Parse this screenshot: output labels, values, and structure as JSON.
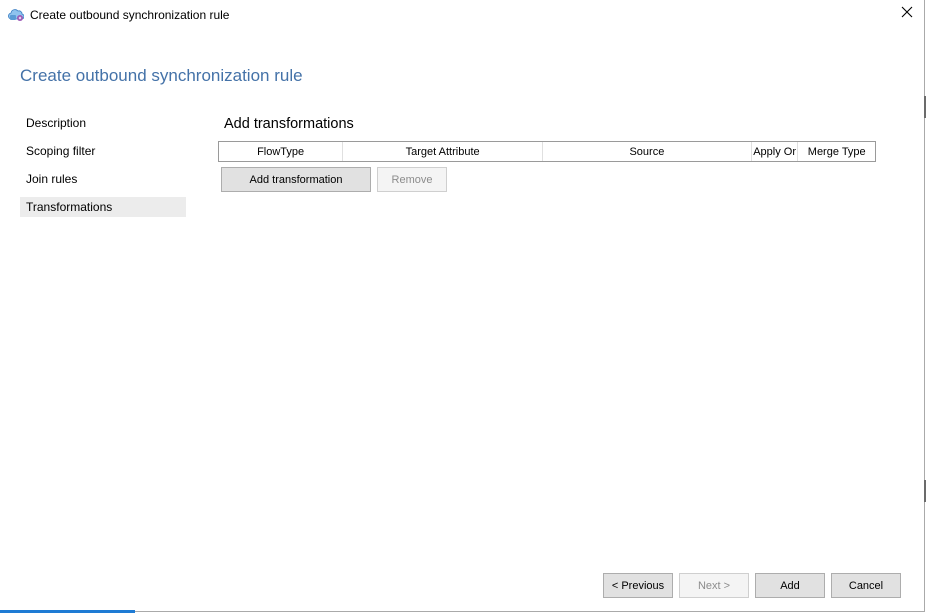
{
  "window": {
    "title": "Create outbound synchronization rule",
    "close_symbol": "✕"
  },
  "page": {
    "title": "Create outbound synchronization rule"
  },
  "nav": {
    "items": [
      {
        "label": "Description",
        "selected": false
      },
      {
        "label": "Scoping filter",
        "selected": false
      },
      {
        "label": "Join rules",
        "selected": false
      },
      {
        "label": "Transformations",
        "selected": true
      }
    ]
  },
  "main": {
    "section_title": "Add transformations",
    "grid": {
      "columns": [
        "FlowType",
        "Target Attribute",
        "Source",
        "Apply Or",
        "Merge Type"
      ],
      "rows": []
    },
    "buttons": {
      "add_transformation": "Add transformation",
      "remove": "Remove"
    }
  },
  "footer": {
    "previous": "< Previous",
    "next": "Next >",
    "add": "Add",
    "cancel": "Cancel"
  },
  "colors": {
    "title_accent": "#4472a8",
    "selected_nav_bg": "#ececec",
    "disabled_text": "#8c8c8c",
    "taskbar_accent": "#1e7bd4"
  }
}
